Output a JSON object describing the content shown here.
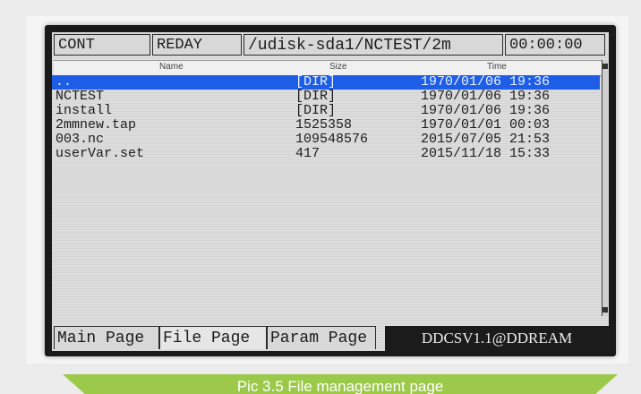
{
  "status": {
    "mode": "CONT",
    "state": "REDAY",
    "path": "/udisk-sda1/NCTEST/2m",
    "clock": "00:00:00"
  },
  "columns": {
    "name": "Name",
    "size": "Size",
    "time": "Time"
  },
  "files": [
    {
      "name": "..",
      "size": "[DIR]",
      "time": "1970/01/06 19:36"
    },
    {
      "name": "NCTEST",
      "size": "[DIR]",
      "time": "1970/01/06 19:36"
    },
    {
      "name": "install",
      "size": "[DIR]",
      "time": "1970/01/06 19:36"
    },
    {
      "name": "2mmnew.tap",
      "size": "1525358",
      "time": "1970/01/01 00:03"
    },
    {
      "name": "003.nc",
      "size": "109548576",
      "time": "2015/07/05 21:53"
    },
    {
      "name": "userVar.set",
      "size": "417",
      "time": "2015/11/18 15:33"
    }
  ],
  "selected_index": 0,
  "tabs": {
    "main": "Main Page",
    "file": "File Page",
    "param": "Param Page"
  },
  "brand": "DDCSV1.1@DDREAM",
  "caption": "Pic 3.5 File management page",
  "colors": {
    "selection": "#1e5ee6",
    "caption_bg": "#9cc94a",
    "screen_bg": "#dcdcdc"
  }
}
